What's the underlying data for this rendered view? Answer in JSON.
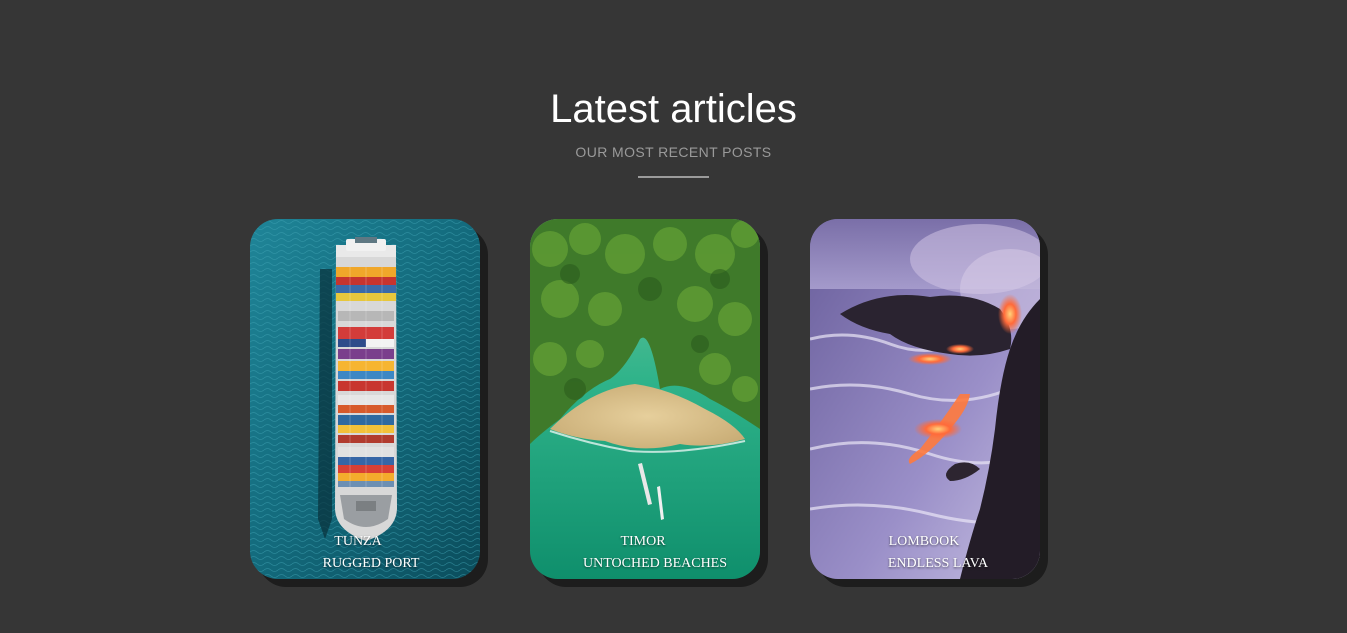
{
  "header": {
    "title": "Latest articles",
    "subtitle": "OUR MOST RECENT POSTS"
  },
  "articles": [
    {
      "place": "TUNZA",
      "headline": "RUGGED PORT",
      "image": "container-ship-aerial"
    },
    {
      "place": "TIMOR",
      "headline": "UNTOCHED BEACHES",
      "image": "tropical-beach-aerial"
    },
    {
      "place": "LOMBOOK",
      "headline": "ENDLESS LAVA",
      "image": "lava-coast"
    }
  ],
  "colors": {
    "background": "#363636",
    "title": "#ffffff",
    "subtitle": "#9a9a9a",
    "divider": "#9b9b9b"
  }
}
